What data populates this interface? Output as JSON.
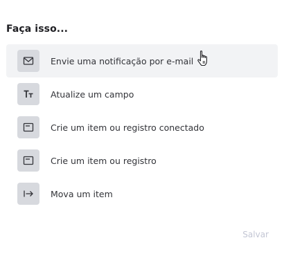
{
  "heading": "Faça isso...",
  "actions": [
    {
      "label": "Envie uma notificação por e-mail",
      "icon": "envelope-icon"
    },
    {
      "label": "Atualize um campo",
      "icon": "text-format-icon"
    },
    {
      "label": "Crie um item ou registro conectado",
      "icon": "card-icon"
    },
    {
      "label": "Crie um item ou registro",
      "icon": "card-icon"
    },
    {
      "label": "Mova um item",
      "icon": "arrow-right-bar-icon"
    }
  ],
  "footer": {
    "save_label": "Salvar"
  },
  "colors": {
    "hover_bg": "#f2f3f5",
    "icon_bg": "#d7d9de",
    "disabled_text": "#c3c6d4"
  }
}
